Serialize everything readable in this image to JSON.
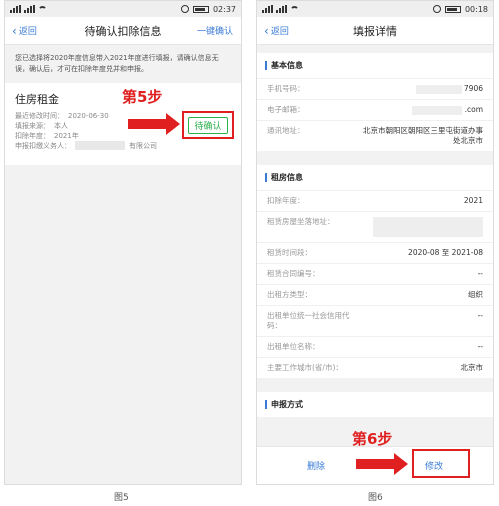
{
  "status_left": {
    "time": "02:37"
  },
  "status_right": {
    "time": "00:18"
  },
  "screen1": {
    "back_label": "返回",
    "title": "待确认扣除信息",
    "right_action": "一键确认",
    "notice": "您已选择将2020年度信息带入2021年度进行填报，请确认信息无误，确认后，才可在扣除年度兑并和申报。",
    "card": {
      "title": "住房租金",
      "rows": [
        {
          "label": "最近修改时间：",
          "value": "2020-06-30"
        },
        {
          "label": "填报来源：",
          "value": "本人"
        },
        {
          "label": "扣除年度：",
          "value": "2021年"
        },
        {
          "label": "申报扣缴义务人：",
          "value": "有限公司"
        }
      ],
      "confirm_button": "待确认"
    },
    "step_label": "第5步",
    "caption": "图5"
  },
  "screen2": {
    "back_label": "返回",
    "title": "填报详情",
    "section_basic": {
      "title": "基本信息",
      "rows": [
        {
          "label": "手机号码：",
          "value": "7906"
        },
        {
          "label": "电子邮箱：",
          "value": ".com"
        },
        {
          "label": "通讯地址：",
          "value": "北京市朝阳区朝阳区三里屯街道办事处北京市"
        }
      ]
    },
    "section_rent": {
      "title": "租房信息",
      "rows": [
        {
          "label": "扣除年度：",
          "value": "2021"
        },
        {
          "label": "租赁房屋坐落地址：",
          "value": ""
        },
        {
          "label": "租赁时间段：",
          "value": "2020-08 至 2021-08"
        },
        {
          "label": "租赁合同编号：",
          "value": "--"
        },
        {
          "label": "出租方类型：",
          "value": "组织"
        },
        {
          "label": "出租单位统一社会信用代码：",
          "value": "--"
        },
        {
          "label": "出租单位名称：",
          "value": "--"
        },
        {
          "label": "主要工作城市(省/市)：",
          "value": "北京市"
        }
      ]
    },
    "section_method": {
      "title": "申报方式"
    },
    "footer": {
      "delete_label": "删除",
      "modify_label": "修改"
    },
    "step_label": "第6步",
    "caption": "图6"
  },
  "colors": {
    "accent": "#3a7bd5",
    "highlight": "#e02020",
    "confirm_green": "#2bb14b"
  }
}
